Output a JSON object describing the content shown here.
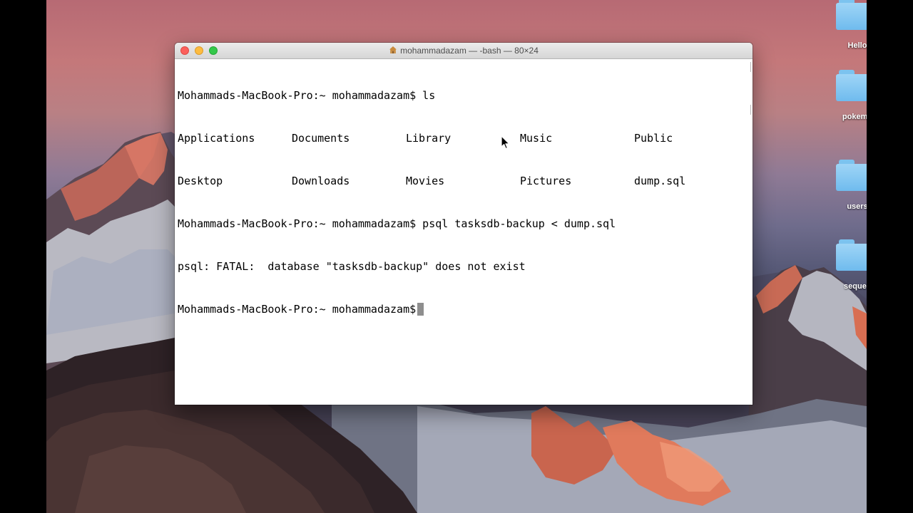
{
  "window": {
    "title": "mohammadazam — -bash — 80×24"
  },
  "terminal": {
    "prompt": "Mohammads-MacBook-Pro:~ mohammadazam$",
    "command1": "ls",
    "ls_rows": [
      [
        "Applications",
        "Documents",
        "Library",
        "Music",
        "Public"
      ],
      [
        "Desktop",
        "Downloads",
        "Movies",
        "Pictures",
        "dump.sql"
      ]
    ],
    "command2": "psql tasksdb-backup < dump.sql",
    "error_line": "psql: FATAL:  database \"tasksdb-backup\" does not exist"
  },
  "desktop_icons": [
    {
      "label": "Hello"
    },
    {
      "label": "pokemo"
    },
    {
      "label": "users"
    },
    {
      "label": "sequeli"
    }
  ],
  "colors": {
    "close": "#fc605c",
    "minimize": "#fdbc40",
    "zoom": "#34c84a",
    "folder": "#6fbbee"
  }
}
